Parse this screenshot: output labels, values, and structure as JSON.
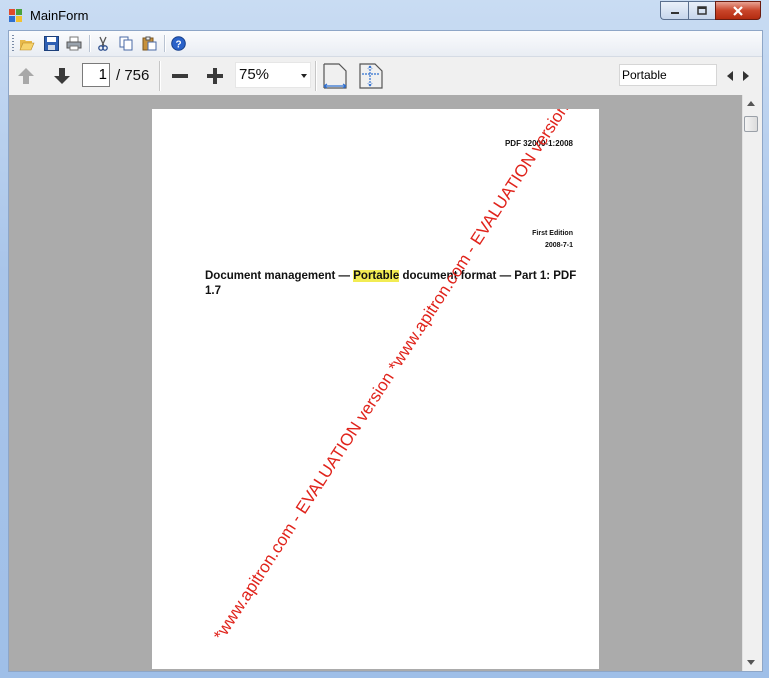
{
  "window": {
    "title": "MainForm"
  },
  "toolbar": {
    "buttons": [
      "open-icon",
      "save-icon",
      "print-icon",
      "cut-icon",
      "copy-icon",
      "paste-icon",
      "help-icon"
    ]
  },
  "nav": {
    "current_page": "1",
    "total_pages": "/ 756",
    "zoom": "75%",
    "search_value": "Portable"
  },
  "document": {
    "standard_number": "PDF 32000-1:2008",
    "edition": "First Edition",
    "date": "2008-7-1",
    "title_before": "Document management — ",
    "title_highlight": "Portable",
    "title_after": " document format — Part 1: PDF 1.7",
    "watermark": "*www.apitron.com - EVALUATION version *www.apitron.com - EVALUATION version *www.a"
  },
  "colors": {
    "highlight": "#f2ec53",
    "watermark": "#e0231b",
    "viewer_bg": "#ababab"
  }
}
